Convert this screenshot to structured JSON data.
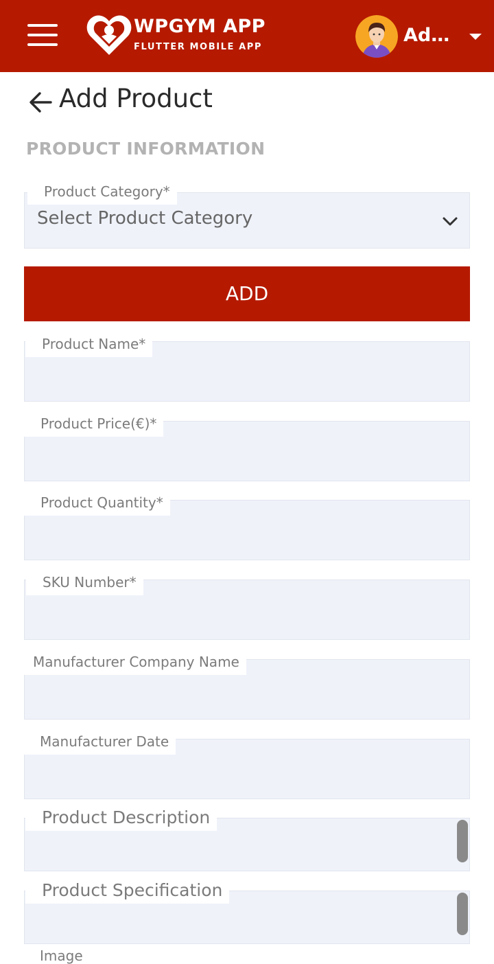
{
  "header": {
    "brand_title": "WPGYM APP",
    "brand_subtitle": "FLUTTER MOBILE APP",
    "user_name": "Ad...",
    "bar_color": "#b51a00"
  },
  "page": {
    "title": "Add Product",
    "section": "PRODUCT INFORMATION"
  },
  "form": {
    "category": {
      "label": "Product Category*",
      "value": "Select Product Category"
    },
    "add_button": "ADD",
    "product_name": {
      "label": "Product Name*",
      "value": ""
    },
    "product_price": {
      "label": "Product Price(€)*",
      "value": ""
    },
    "product_quantity": {
      "label": "Product Quantity*",
      "value": ""
    },
    "sku_number": {
      "label": "SKU Number*",
      "value": ""
    },
    "manufacturer_company": {
      "label": "Manufacturer Company Name",
      "value": ""
    },
    "manufacturer_date": {
      "label": "Manufacturer Date",
      "value": ""
    },
    "product_description": {
      "label": "Product Description",
      "value": ""
    },
    "product_specification": {
      "label": "Product Specification",
      "value": ""
    },
    "image": {
      "label": "Image"
    }
  },
  "icons": {
    "menu": "hamburger-menu-icon",
    "logo": "heart-logo-icon",
    "avatar": "user-avatar",
    "caret": "caret-down-icon",
    "back": "arrow-left-icon",
    "chevron": "chevron-down-icon"
  }
}
